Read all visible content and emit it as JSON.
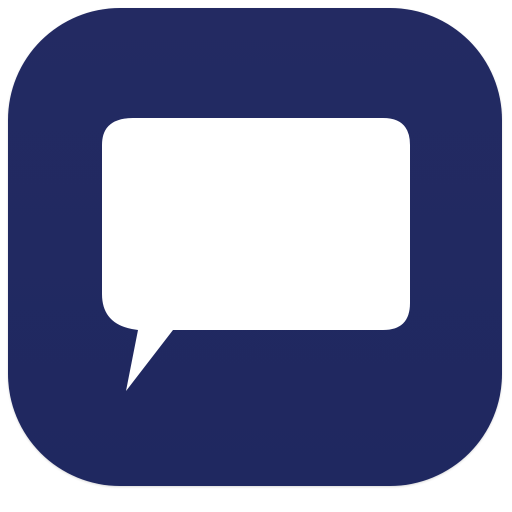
{
  "app_icon": {
    "icon": "chat-bubble-icon",
    "colors": {
      "background_top": "#232a62",
      "background_bottom": "#1f2860",
      "bubble": "#ffffff"
    }
  }
}
